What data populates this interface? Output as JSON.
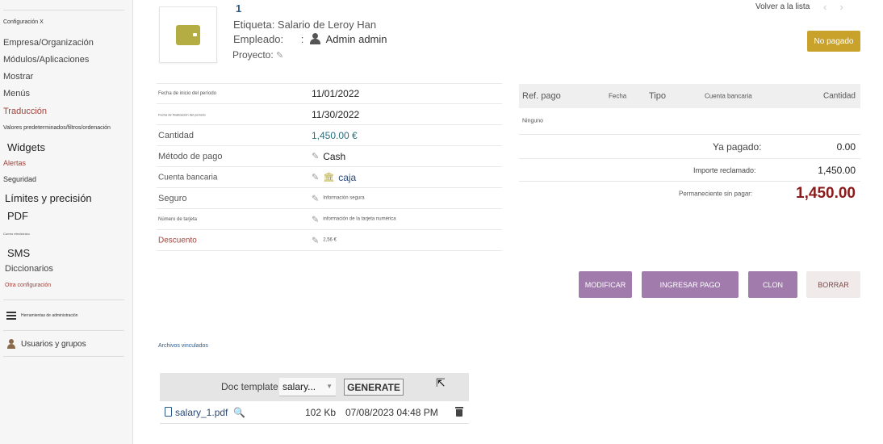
{
  "sidebar": {
    "items": [
      {
        "label": "Configuración X"
      },
      {
        "label": "Empresa/Organización"
      },
      {
        "label": "Módulos/Aplicaciones"
      },
      {
        "label": "Mostrar"
      },
      {
        "label": "Menús"
      },
      {
        "label": "Traducción"
      },
      {
        "label": "Valores predeterminados/filtros/ordenación"
      },
      {
        "label": "Widgets"
      },
      {
        "label": "Alertas"
      },
      {
        "label": "Seguridad"
      },
      {
        "label": "Límites y precisión"
      },
      {
        "label": "PDF"
      },
      {
        "label": "Correo electrónico"
      },
      {
        "label": "SMS"
      },
      {
        "label": "Diccionarios"
      },
      {
        "label": "Otra configuración"
      }
    ],
    "admin_tools_label": "Herramientas de administración",
    "users_groups_label": "Usuarios y grupos"
  },
  "header": {
    "ref": "1",
    "label_line": "Etiqueta: Salario de Leroy Han",
    "employee_label": "Empleado:",
    "employee_value": "Admin admin",
    "project_label": "Proyecto:",
    "back_link": "Volver a la lista",
    "status": "No pagado",
    "status_color": "#c9a22c"
  },
  "fields": {
    "period_start_label": "Fecha de inicio del período",
    "period_start_value": "11/01/2022",
    "period_end_label": "Fecha de finalización del período",
    "period_end_value": "11/30/2022",
    "amount_label": "Cantidad",
    "amount_value": "1,450.00 €",
    "payment_method_label": "Método de pago",
    "payment_method_value": "Cash",
    "bank_account_label": "Cuenta bancaria",
    "bank_account_value": "caja",
    "insurance_label": "Seguro",
    "insurance_value": "Información segura",
    "card_number_label": "Número de tarjeta",
    "card_number_value": "información de la tarjeta numérica",
    "discount_label": "Descuento",
    "discount_value": "2,56 €"
  },
  "payments": {
    "headers": {
      "ref": "Ref. pago",
      "date": "Fecha",
      "type": "Tipo",
      "account": "Cuenta bancaria",
      "amount": "Cantidad"
    },
    "none_text": "Ninguno",
    "already_paid_label": "Ya pagado:",
    "already_paid_value": "0.00",
    "claimed_label": "Importe reclamado:",
    "claimed_value": "1,450.00",
    "remaining_label": "Permaneciente sin pagar:",
    "remaining_value": "1,450.00",
    "remaining_color": "#8b1a1a"
  },
  "actions": {
    "modify": "MODIFICAR",
    "enter_payment": "INGRESAR PAGO",
    "clone": "CLON",
    "delete": "BORRAR"
  },
  "linked_files_label": "Archivos vinculados",
  "doc": {
    "template_label": "Doc template",
    "template_value": "salary...",
    "generate": "GENERATE",
    "file_name": "salary_1.pdf",
    "file_size": "102 Kb",
    "file_date": "07/08/2023 04:48 PM"
  }
}
